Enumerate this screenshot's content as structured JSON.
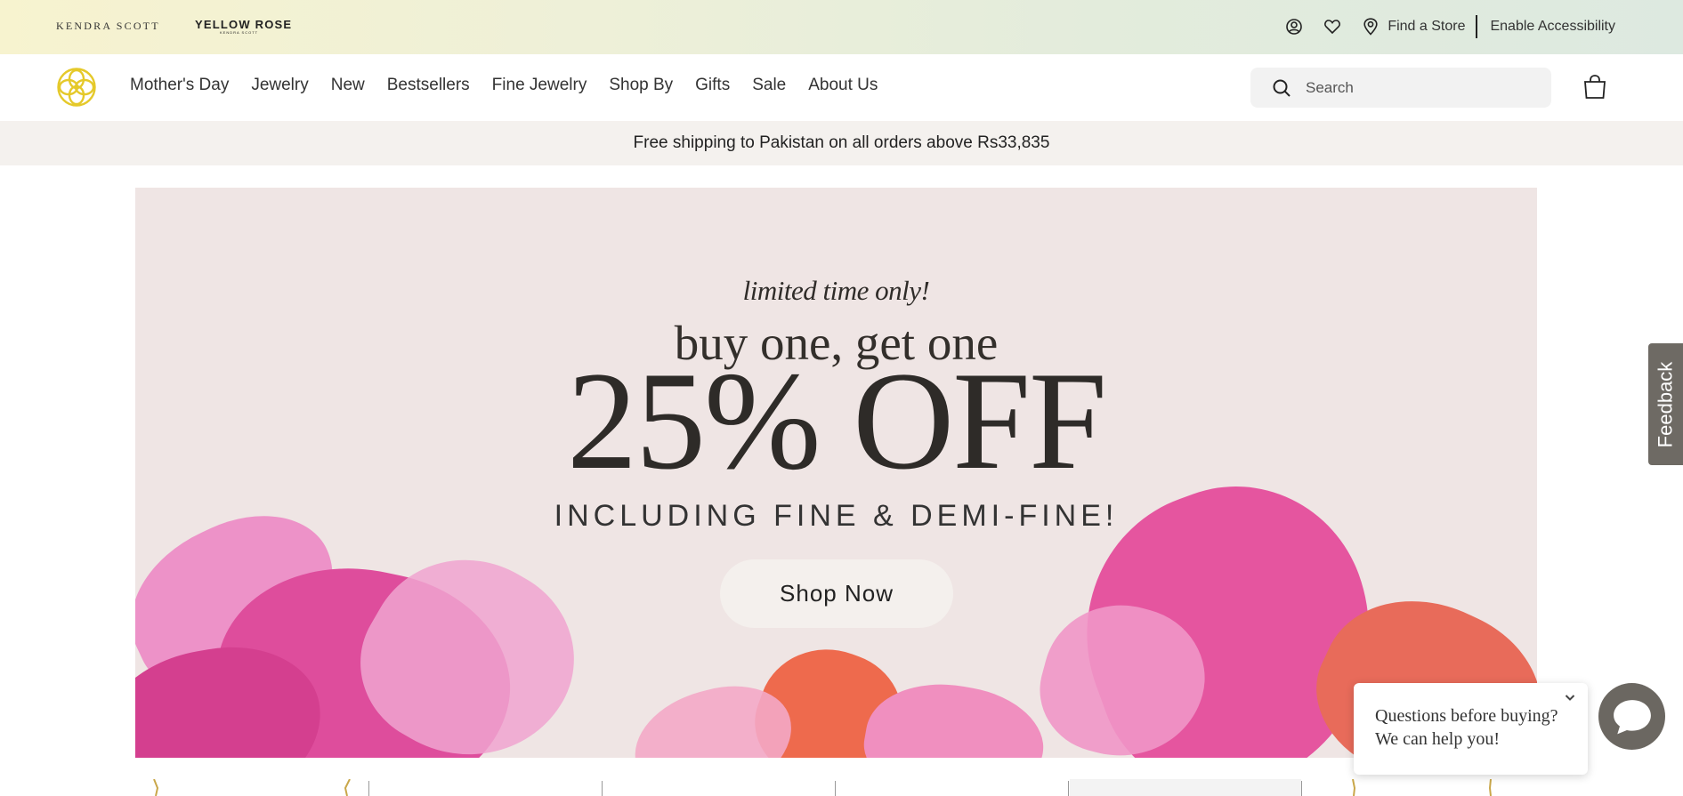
{
  "utility": {
    "brand_primary": "KENDRA SCOTT",
    "brand_secondary": "YELLOW ROSE",
    "brand_secondary_sub": "KENDRA SCOTT",
    "find_store": "Find a Store",
    "accessibility": "Enable Accessibility",
    "icons": [
      "account-icon",
      "heart-icon",
      "location-pin-icon"
    ]
  },
  "nav": {
    "items": [
      "Mother's Day",
      "Jewelry",
      "New",
      "Bestsellers",
      "Fine Jewelry",
      "Shop By",
      "Gifts",
      "Sale",
      "About Us"
    ]
  },
  "search": {
    "placeholder": "Search"
  },
  "shipping": {
    "text": "Free shipping to Pakistan on all orders above Rs33,835"
  },
  "hero": {
    "tagline": "limited time only!",
    "line": "buy one, get one",
    "headline": "25% OFF",
    "subline": "INCLUDING FINE & DEMI-FINE!",
    "cta": "Shop Now"
  },
  "feedback": {
    "label": "Feedback"
  },
  "chat": {
    "line1": "Questions before buying?",
    "line2": "We can help you!"
  },
  "colors": {
    "utility_bar_start": "#f7f3cf",
    "utility_bar_end": "#dde9e0",
    "brand_gold": "#e5c92a",
    "hero_bg": "#efe5e4",
    "petal_pink": "#e0529e",
    "feedback_bg": "#6e6a64"
  }
}
